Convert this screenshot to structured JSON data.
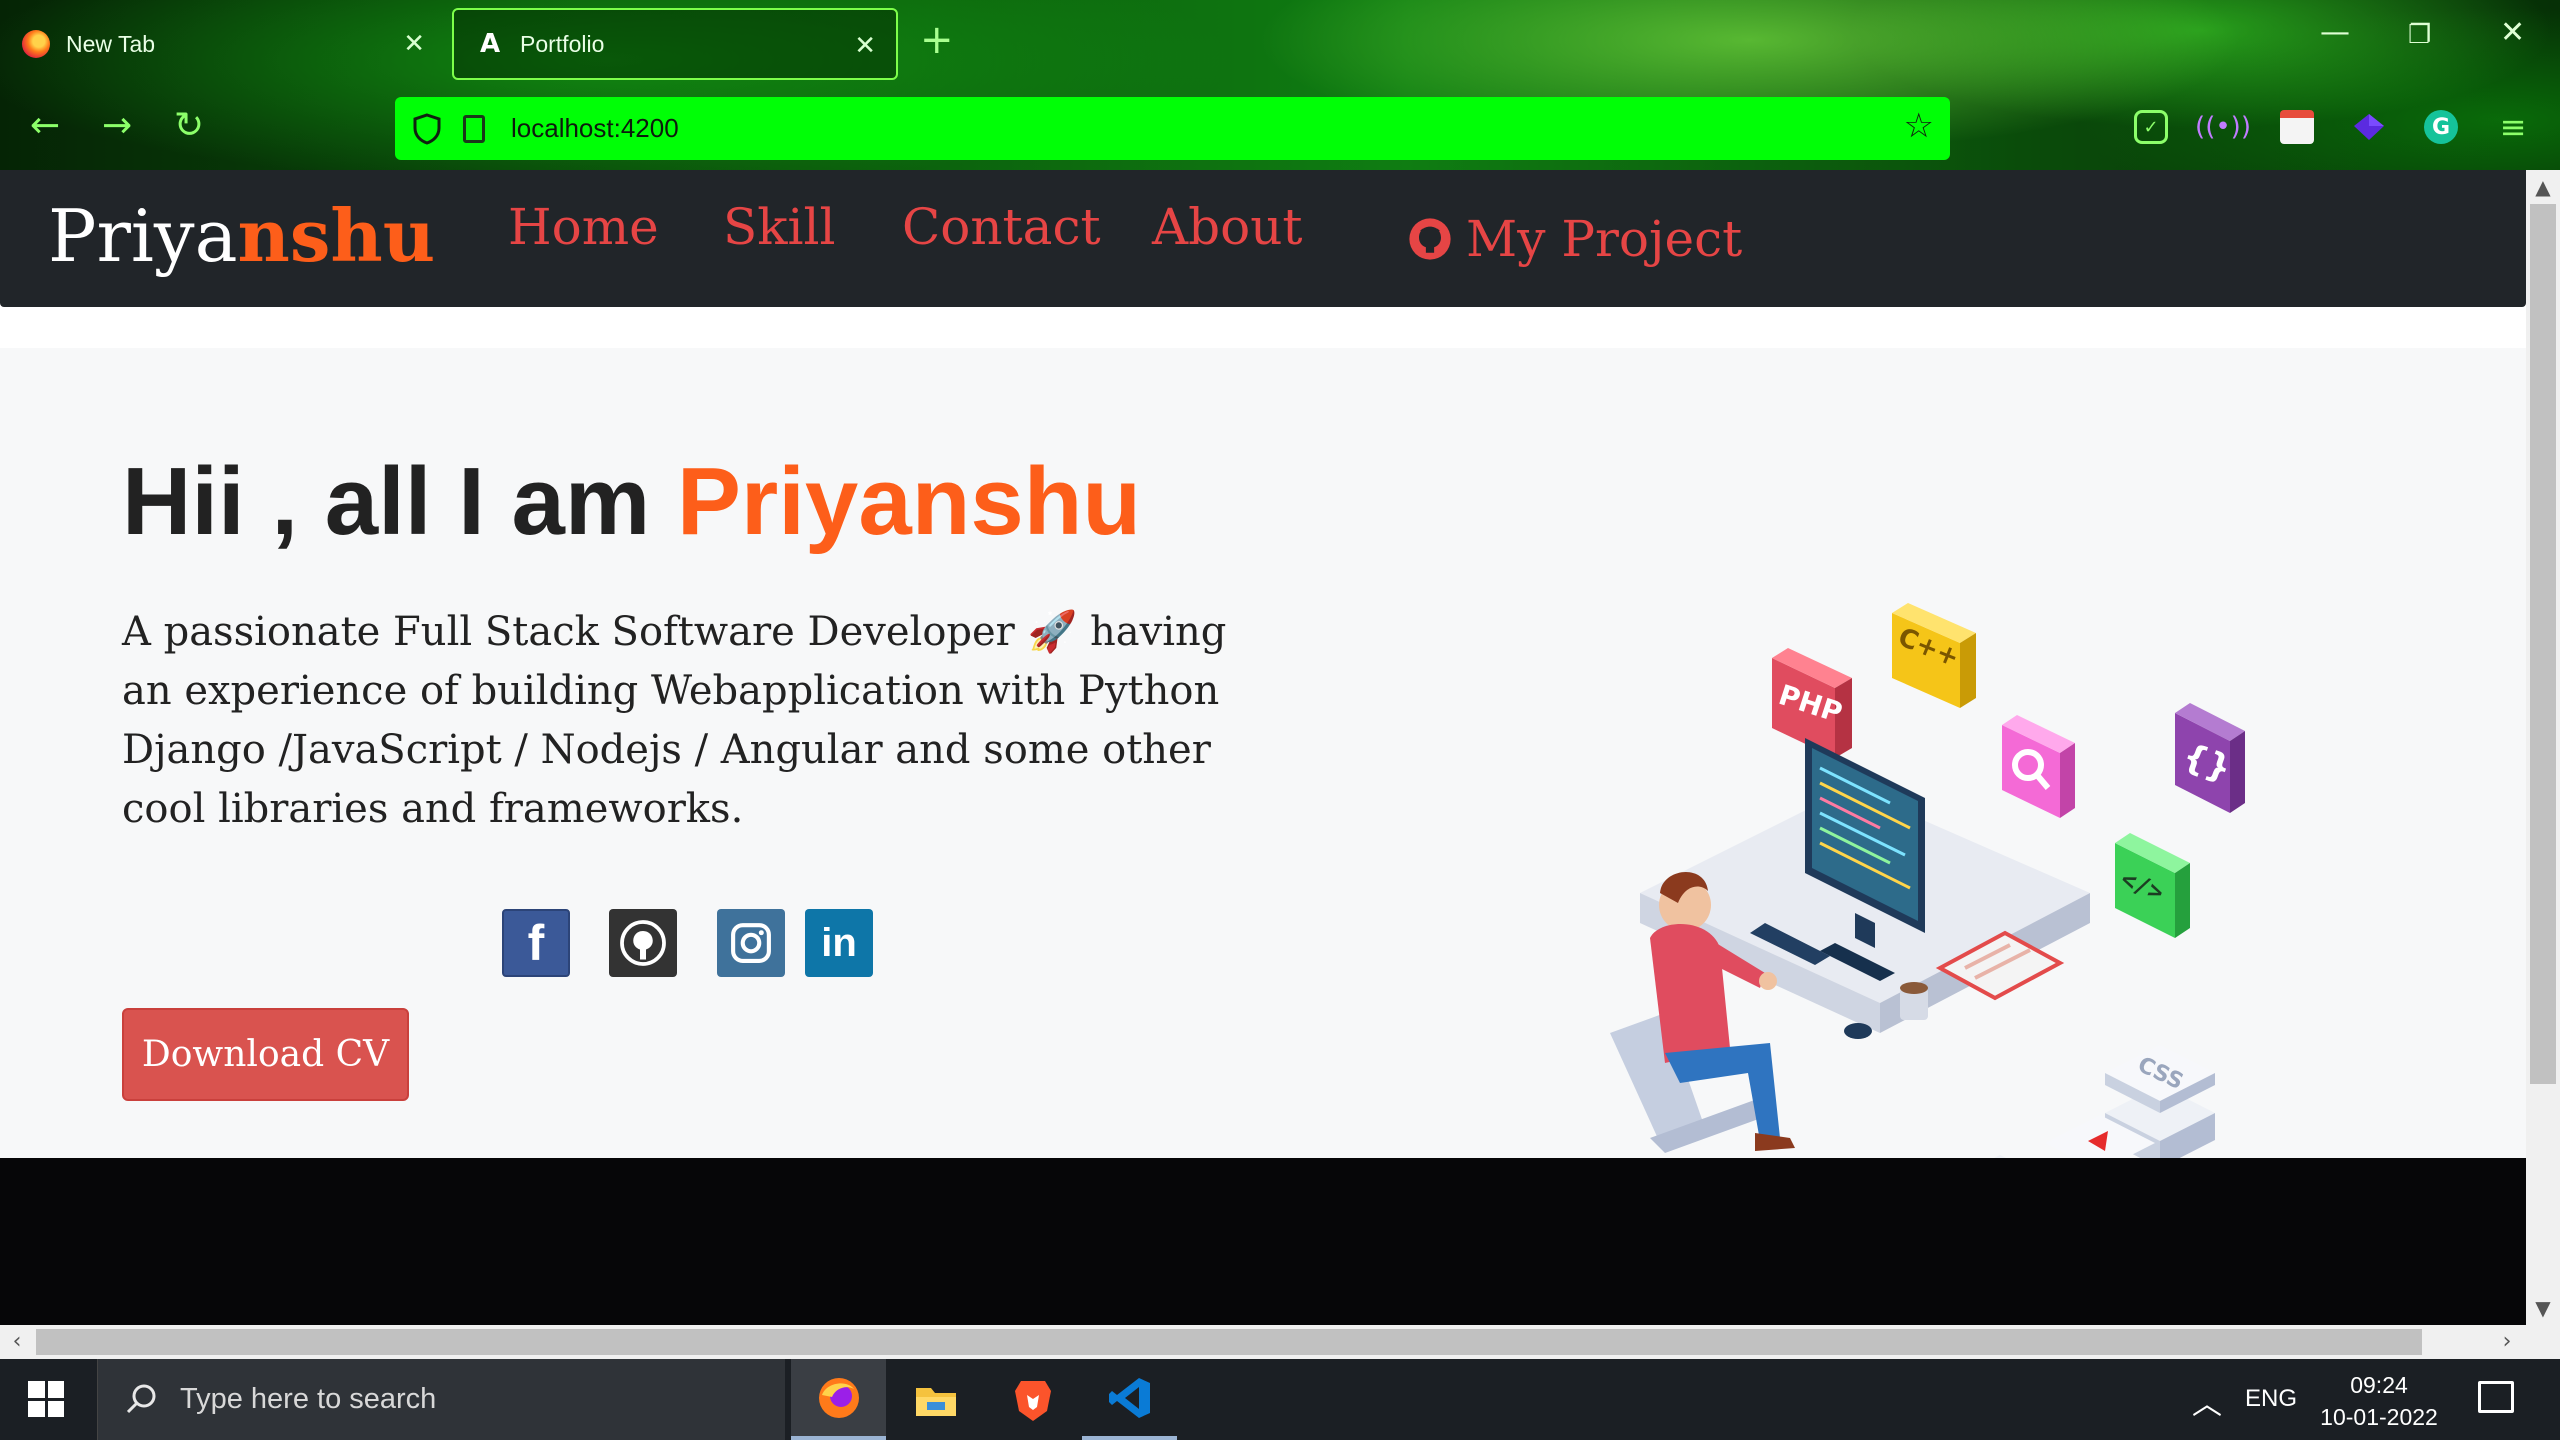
{
  "browser": {
    "tabs": [
      {
        "label": "New Tab",
        "active": false
      },
      {
        "label": "Portfolio",
        "active": true
      }
    ],
    "new_tab_symbol": "+",
    "url": "localhost:4200",
    "accent_color": "#00ff06",
    "icons": [
      "firefox-icon",
      "angular-icon",
      "back-icon",
      "forward-icon",
      "reload-icon",
      "shield-icon",
      "page-icon",
      "star-icon",
      "pocket-icon",
      "radio-icon",
      "calendar-icon",
      "gem-icon",
      "grammarly-icon",
      "menu-icon"
    ]
  },
  "site": {
    "brand_first": "Priya",
    "brand_second": "nshu",
    "brand_color": "#fd5e1a",
    "nav_color": "#e64545",
    "nav": {
      "home": "Home",
      "skill": "Skill",
      "contact": "Contact",
      "about": "About",
      "project": "My Project"
    },
    "hero": {
      "greeting": "Hii , all I am ",
      "name": "Priyanshu",
      "paragraph": "A passionate Full Stack Software Developer 🚀 having an experience of building Webapplication with Python Django /JavaScript / Nodejs / Angular and some other cool libraries and frameworks.",
      "social": {
        "facebook_glyph": "f",
        "linkedin_glyph": "in"
      },
      "download_label": "Download CV",
      "illustration_labels": {
        "php": "PHP",
        "cpp": "C++",
        "braces": "{}",
        "code": "</>",
        "css": "CSS"
      }
    }
  },
  "taskbar": {
    "search_placeholder": "Type here to search",
    "language": "ENG",
    "time": "09:24",
    "date": "10-01-2022"
  }
}
